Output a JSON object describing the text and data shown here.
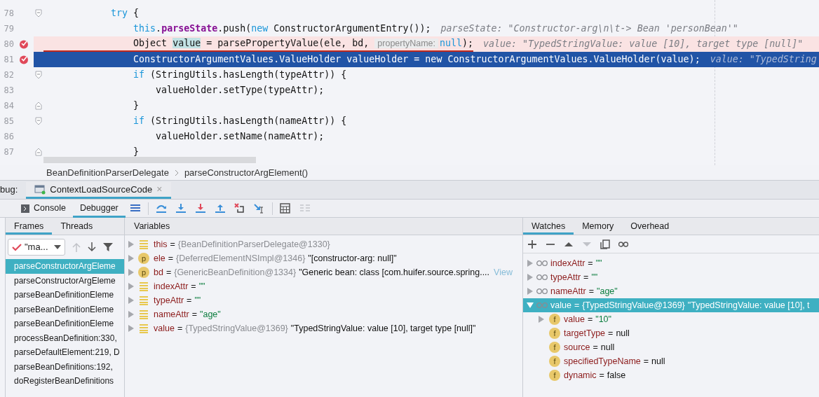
{
  "editor": {
    "lines": [
      {
        "number": "78",
        "breakpoint": false,
        "current": false,
        "fold_start": true,
        "fold_end": false,
        "segments": [
          {
            "kind": "keyword",
            "text": "            try"
          },
          {
            "kind": "plain",
            "text": " {"
          }
        ]
      },
      {
        "number": "79",
        "breakpoint": false,
        "current": false,
        "fold_start": false,
        "fold_end": false,
        "segments": [
          {
            "kind": "keyword",
            "text": "                this"
          },
          {
            "kind": "plain",
            "text": "."
          },
          {
            "kind": "field",
            "text": "parseState"
          },
          {
            "kind": "plain",
            "text": ".push("
          },
          {
            "kind": "keyword",
            "text": "new"
          },
          {
            "kind": "plain",
            "text": " ConstructorArgumentEntry());"
          }
        ],
        "value_hint": "parseState: \"Constructor-arg\\n\\t-> Bean 'personBean'\""
      },
      {
        "number": "80",
        "breakpoint": true,
        "current": false,
        "fold_start": false,
        "fold_end": false,
        "segments": [
          {
            "kind": "plain",
            "text": "                Object "
          },
          {
            "kind": "usage",
            "text": "value"
          },
          {
            "kind": "plain",
            "text": " = parsePropertyValue(ele, bd, "
          },
          {
            "kind": "inlay",
            "text": "propertyName:"
          },
          {
            "kind": "keyword",
            "text": "null"
          },
          {
            "kind": "plain",
            "text": ");"
          }
        ],
        "value_hint": "value: \"TypedStringValue: value [10], target type [null]\""
      },
      {
        "number": "81",
        "breakpoint": true,
        "current": true,
        "fold_start": false,
        "fold_end": false,
        "segments": [
          {
            "kind": "plain",
            "text": "                ConstructorArgumentValues.ValueHolder valueHolder = new ConstructorArgumentValues.ValueHolder(value);"
          }
        ],
        "value_hint": "value: \"TypedString"
      },
      {
        "number": "82",
        "breakpoint": false,
        "current": false,
        "fold_start": true,
        "fold_end": false,
        "segments": [
          {
            "kind": "keyword",
            "text": "                if"
          },
          {
            "kind": "plain",
            "text": " (StringUtils.hasLength(typeAttr)) {"
          }
        ]
      },
      {
        "number": "83",
        "breakpoint": false,
        "current": false,
        "fold_start": false,
        "fold_end": false,
        "segments": [
          {
            "kind": "plain",
            "text": "                    valueHolder.setType(typeAttr);"
          }
        ]
      },
      {
        "number": "84",
        "breakpoint": false,
        "current": false,
        "fold_start": false,
        "fold_end": true,
        "segments": [
          {
            "kind": "plain",
            "text": "                }"
          }
        ]
      },
      {
        "number": "85",
        "breakpoint": false,
        "current": false,
        "fold_start": true,
        "fold_end": false,
        "segments": [
          {
            "kind": "keyword",
            "text": "                if"
          },
          {
            "kind": "plain",
            "text": " (StringUtils.hasLength(nameAttr)) {"
          }
        ]
      },
      {
        "number": "86",
        "breakpoint": false,
        "current": false,
        "fold_start": false,
        "fold_end": false,
        "segments": [
          {
            "kind": "plain",
            "text": "                    valueHolder.setName(nameAttr);"
          }
        ]
      },
      {
        "number": "87",
        "breakpoint": false,
        "current": false,
        "fold_start": false,
        "fold_end": true,
        "segments": [
          {
            "kind": "plain",
            "text": "                }"
          }
        ]
      }
    ]
  },
  "breadcrumbs": [
    "BeanDefinitionParserDelegate",
    "parseConstructorArgElement()"
  ],
  "debug": {
    "label": "bug:",
    "session_tab": "ContextLoadSourceCode",
    "close": "×",
    "tabs": [
      {
        "label": "Console",
        "selected": false
      },
      {
        "label": "Debugger",
        "selected": true
      }
    ],
    "frames": {
      "tabs": [
        {
          "label": "Frames",
          "selected": true
        },
        {
          "label": "Threads",
          "selected": false
        }
      ],
      "thread": "\"ma...",
      "items": [
        {
          "label": "parseConstructorArgEleme",
          "selected": true
        },
        {
          "label": "parseConstructorArgEleme",
          "selected": false
        },
        {
          "label": "parseBeanDefinitionEleme",
          "selected": false
        },
        {
          "label": "parseBeanDefinitionEleme",
          "selected": false
        },
        {
          "label": "parseBeanDefinitionEleme",
          "selected": false
        },
        {
          "label": "processBeanDefinition:330,",
          "selected": false
        },
        {
          "label": "parseDefaultElement:219, D",
          "selected": false
        },
        {
          "label": "parseBeanDefinitions:192,",
          "selected": false
        },
        {
          "label": "doRegisterBeanDefinitions",
          "selected": false
        }
      ]
    },
    "variables": {
      "title": "Variables",
      "items": [
        {
          "kind": "local",
          "name": "this",
          "operator": "=",
          "ref": "{BeanDefinitionParserDelegate@1330}"
        },
        {
          "kind": "param",
          "badge": "p",
          "name": "ele",
          "operator": "=",
          "ref": "{DeferredElementNSImpl@1346}",
          "value": "\"[constructor-arg: null]\"",
          "string": false
        },
        {
          "kind": "param",
          "badge": "p",
          "name": "bd",
          "operator": "=",
          "ref": "{GenericBeanDefinition@1334}",
          "value": "\"Generic bean: class [com.huifer.source.spring....",
          "string": false,
          "link": "View"
        },
        {
          "kind": "local",
          "name": "indexAttr",
          "operator": "=",
          "value": "\"\"",
          "string": true
        },
        {
          "kind": "local",
          "name": "typeAttr",
          "operator": "=",
          "value": "\"\"",
          "string": true
        },
        {
          "kind": "local",
          "name": "nameAttr",
          "operator": "=",
          "value": "\"age\"",
          "string": true
        },
        {
          "kind": "local",
          "name": "value",
          "operator": "=",
          "ref": "{TypedStringValue@1369}",
          "value": "\"TypedStringValue: value [10], target type [null]\"",
          "string": false
        }
      ]
    },
    "watches": {
      "tabs": [
        {
          "label": "Watches",
          "selected": true
        },
        {
          "label": "Memory",
          "selected": false
        },
        {
          "label": "Overhead",
          "selected": false
        }
      ],
      "items": [
        {
          "name": "indexAttr",
          "operator": "=",
          "value": "\"\"",
          "string": true,
          "expanded": false,
          "selected": false
        },
        {
          "name": "typeAttr",
          "operator": "=",
          "value": "\"\"",
          "string": true,
          "expanded": false,
          "selected": false
        },
        {
          "name": "nameAttr",
          "operator": "=",
          "value": "\"age\"",
          "string": true,
          "expanded": false,
          "selected": false
        },
        {
          "name": "value",
          "operator": "=",
          "ref": "{TypedStringValue@1369}",
          "value": "\"TypedStringValue: value [10], t",
          "expanded": true,
          "selected": true,
          "children": [
            {
              "badge": "f",
              "name": "value",
              "operator": "=",
              "value": "\"10\"",
              "string": true,
              "expandable": true
            },
            {
              "badge": "f",
              "name": "targetType",
              "operator": "=",
              "value": "null",
              "string": false,
              "expandable": false
            },
            {
              "badge": "f",
              "name": "source",
              "operator": "=",
              "value": "null",
              "string": false,
              "expandable": false
            },
            {
              "badge": "f",
              "name": "specifiedTypeName",
              "operator": "=",
              "value": "null",
              "string": false,
              "expandable": false
            },
            {
              "badge": "f",
              "name": "dynamic",
              "operator": "=",
              "value": "false",
              "string": false,
              "expandable": false
            }
          ]
        }
      ]
    }
  }
}
